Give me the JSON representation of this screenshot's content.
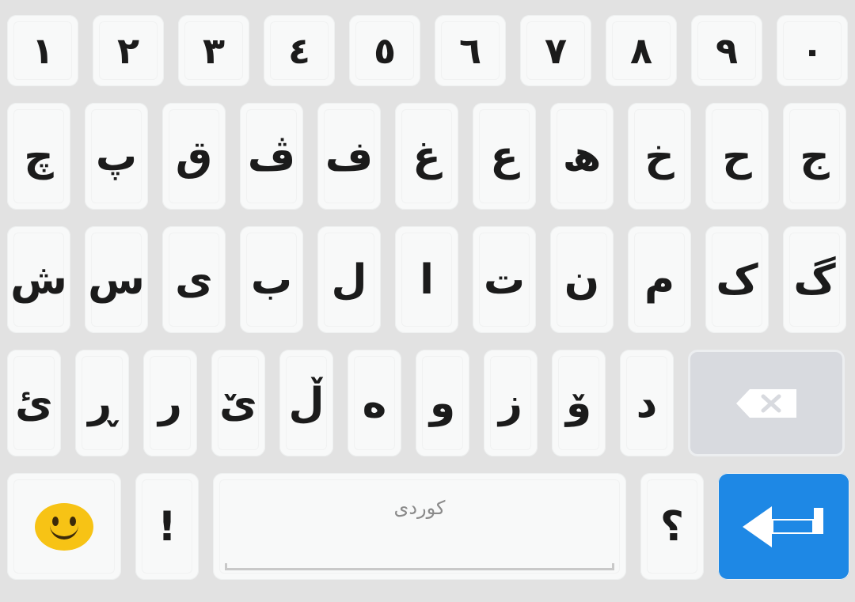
{
  "keyboard": {
    "row1": [
      "١",
      "٢",
      "٣",
      "٤",
      "٥",
      "٦",
      "٧",
      "٨",
      "٩",
      "٠"
    ],
    "row2": [
      "چ",
      "پ",
      "ق",
      "ڤ",
      "ف",
      "غ",
      "ع",
      "ھ",
      "خ",
      "ح",
      "ج"
    ],
    "row3": [
      "ش",
      "س",
      "ی",
      "ب",
      "ل",
      "ا",
      "ت",
      "ن",
      "م",
      "ک",
      "گ"
    ],
    "row4": [
      "ئ",
      "ڕ",
      "ر",
      "ێ",
      "ڵ",
      "ە",
      "و",
      "ز",
      "ۆ",
      "د"
    ],
    "row5": {
      "exclaim": "!",
      "space_label": "كوردی",
      "question": "؟"
    }
  },
  "colors": {
    "background": "#e2e2e2",
    "key": "#f8f9f9",
    "enter": "#1e88e5",
    "delete": "#d8dadf"
  },
  "icons": {
    "delete": "backspace-icon",
    "enter": "enter-arrow-icon",
    "emoji": "smiley-emoji-icon"
  }
}
